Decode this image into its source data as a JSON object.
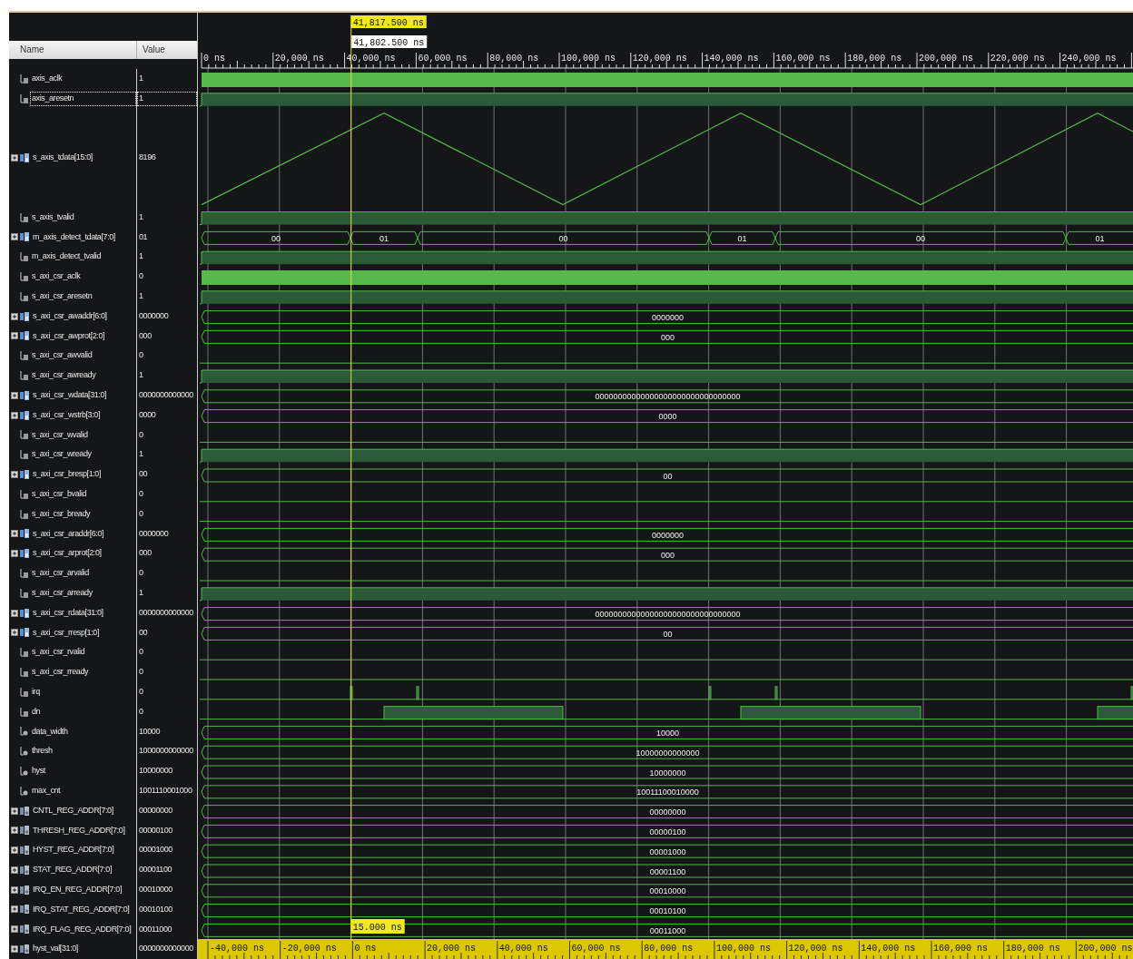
{
  "columns": {
    "name": "Name",
    "value": "Value"
  },
  "cursors": {
    "main": "41,817.500 ns",
    "secondary": "41,802.500 ns",
    "delta": "15.000 ns"
  },
  "time_ruler": [
    "0 ns",
    "20,000 ns",
    "40,000 ns",
    "60,000 ns",
    "80,000 ns",
    "100,000 ns",
    "120,000 ns",
    "140,000 ns",
    "160,000 ns",
    "180,000 ns",
    "200,000 ns",
    "220,000 ns",
    "240,000 ns"
  ],
  "relative_ruler": [
    "-40,000 ns",
    "-20,000 ns",
    "0 ns",
    "20,000 ns",
    "40,000 ns",
    "60,000 ns",
    "80,000 ns",
    "100,000 ns",
    "120,000 ns",
    "140,000 ns",
    "160,000 ns",
    "180,000 ns",
    "200,000 ns"
  ],
  "signals": [
    {
      "name": "axis_aclk",
      "value": "1",
      "expandable": false,
      "kind": "clock",
      "selected": false
    },
    {
      "name": "axis_aresetn",
      "value": "1",
      "expandable": false,
      "kind": "high",
      "selected": true
    },
    {
      "name": "s_axis_tdata[15:0]",
      "value": "8196",
      "expandable": true,
      "kind": "analog",
      "selected": false
    },
    {
      "name": "s_axis_tvalid",
      "value": "1",
      "expandable": false,
      "kind": "high",
      "selected": false
    },
    {
      "name": "m_axis_detect_tdata[7:0]",
      "value": "01",
      "expandable": true,
      "kind": "bus",
      "selected": false,
      "segments": [
        {
          "label": "00"
        },
        {
          "label": "01"
        },
        {
          "label": "00"
        },
        {
          "label": "01"
        },
        {
          "label": "00"
        },
        {
          "label": "01"
        }
      ]
    },
    {
      "name": "m_axis_detect_tvalid",
      "value": "1",
      "expandable": false,
      "kind": "high",
      "selected": false
    },
    {
      "name": "s_axi_csr_aclk",
      "value": "0",
      "expandable": false,
      "kind": "clock",
      "selected": false
    },
    {
      "name": "s_axi_csr_aresetn",
      "value": "1",
      "expandable": false,
      "kind": "high",
      "selected": false
    },
    {
      "name": "s_axi_csr_awaddr[6:0]",
      "value": "0000000",
      "expandable": true,
      "kind": "bus",
      "selected": false,
      "segments": [
        {
          "label": "0000000"
        }
      ]
    },
    {
      "name": "s_axi_csr_awprot[2:0]",
      "value": "000",
      "expandable": true,
      "kind": "bus",
      "selected": false,
      "segments": [
        {
          "label": "000"
        }
      ]
    },
    {
      "name": "s_axi_csr_awvalid",
      "value": "0",
      "expandable": false,
      "kind": "low",
      "selected": false
    },
    {
      "name": "s_axi_csr_awready",
      "value": "1",
      "expandable": false,
      "kind": "high",
      "selected": false
    },
    {
      "name": "s_axi_csr_wdata[31:0]",
      "value": "0000000000000",
      "expandable": true,
      "kind": "bus",
      "selected": false,
      "segments": [
        {
          "label": "00000000000000000000000000000000"
        }
      ]
    },
    {
      "name": "s_axi_csr_wstrb[3:0]",
      "value": "0000",
      "expandable": true,
      "kind": "bus",
      "selected": false,
      "segments": [
        {
          "label": "0000"
        }
      ]
    },
    {
      "name": "s_axi_csr_wvalid",
      "value": "0",
      "expandable": false,
      "kind": "low",
      "selected": false
    },
    {
      "name": "s_axi_csr_wready",
      "value": "1",
      "expandable": false,
      "kind": "high",
      "selected": false
    },
    {
      "name": "s_axi_csr_bresp[1:0]",
      "value": "00",
      "expandable": true,
      "kind": "bus",
      "selected": false,
      "segments": [
        {
          "label": "00"
        }
      ]
    },
    {
      "name": "s_axi_csr_bvalid",
      "value": "0",
      "expandable": false,
      "kind": "low",
      "selected": false
    },
    {
      "name": "s_axi_csr_bready",
      "value": "0",
      "expandable": false,
      "kind": "low",
      "selected": false
    },
    {
      "name": "s_axi_csr_araddr[6:0]",
      "value": "0000000",
      "expandable": true,
      "kind": "bus",
      "selected": false,
      "segments": [
        {
          "label": "0000000"
        }
      ]
    },
    {
      "name": "s_axi_csr_arprot[2:0]",
      "value": "000",
      "expandable": true,
      "kind": "bus",
      "selected": false,
      "segments": [
        {
          "label": "000"
        }
      ]
    },
    {
      "name": "s_axi_csr_arvalid",
      "value": "0",
      "expandable": false,
      "kind": "low",
      "selected": false
    },
    {
      "name": "s_axi_csr_arready",
      "value": "1",
      "expandable": false,
      "kind": "high",
      "selected": false
    },
    {
      "name": "s_axi_csr_rdata[31:0]",
      "value": "0000000000000",
      "expandable": true,
      "kind": "bus",
      "selected": false,
      "segments": [
        {
          "label": "00000000000000000000000000000000"
        }
      ]
    },
    {
      "name": "s_axi_csr_rresp[1:0]",
      "value": "00",
      "expandable": true,
      "kind": "bus",
      "selected": false,
      "segments": [
        {
          "label": "00"
        }
      ]
    },
    {
      "name": "s_axi_csr_rvalid",
      "value": "0",
      "expandable": false,
      "kind": "low",
      "selected": false
    },
    {
      "name": "s_axi_csr_rready",
      "value": "0",
      "expandable": false,
      "kind": "low",
      "selected": false
    },
    {
      "name": "irq",
      "value": "0",
      "expandable": false,
      "kind": "spikes",
      "selected": false
    },
    {
      "name": "dn",
      "value": "0",
      "expandable": false,
      "kind": "pulses",
      "selected": false
    },
    {
      "name": "data_width",
      "value": "10000",
      "expandable": false,
      "kind": "bus",
      "selected": false,
      "segments": [
        {
          "label": "10000"
        }
      ]
    },
    {
      "name": "thresh",
      "value": "1000000000000",
      "expandable": false,
      "kind": "bus",
      "selected": false,
      "segments": [
        {
          "label": "10000000000000"
        }
      ]
    },
    {
      "name": "hyst",
      "value": "10000000",
      "expandable": false,
      "kind": "bus",
      "selected": false,
      "segments": [
        {
          "label": "10000000"
        }
      ]
    },
    {
      "name": "max_cnt",
      "value": "1001110001000",
      "expandable": false,
      "kind": "bus",
      "selected": false,
      "segments": [
        {
          "label": "10011100010000"
        }
      ]
    },
    {
      "name": "CNTL_REG_ADDR[7:0]",
      "value": "00000000",
      "expandable": true,
      "kind": "bus",
      "selected": false,
      "segments": [
        {
          "label": "00000000"
        }
      ]
    },
    {
      "name": "THRESH_REG_ADDR[7:0]",
      "value": "00000100",
      "expandable": true,
      "kind": "bus",
      "selected": false,
      "segments": [
        {
          "label": "00000100"
        }
      ]
    },
    {
      "name": "HYST_REG_ADDR[7:0]",
      "value": "00001000",
      "expandable": true,
      "kind": "bus",
      "selected": false,
      "segments": [
        {
          "label": "00001000"
        }
      ]
    },
    {
      "name": "STAT_REG_ADDR[7:0]",
      "value": "00001100",
      "expandable": true,
      "kind": "bus",
      "selected": false,
      "segments": [
        {
          "label": "00001100"
        }
      ]
    },
    {
      "name": "IRQ_EN_REG_ADDR[7:0]",
      "value": "00010000",
      "expandable": true,
      "kind": "bus",
      "selected": false,
      "segments": [
        {
          "label": "00010000"
        }
      ]
    },
    {
      "name": "IRQ_STAT_REG_ADDR[7:0]",
      "value": "00010100",
      "expandable": true,
      "kind": "bus",
      "selected": false,
      "segments": [
        {
          "label": "00010100"
        }
      ]
    },
    {
      "name": "IRQ_FLAG_REG_ADDR[7:0]",
      "value": "00011000",
      "expandable": true,
      "kind": "bus",
      "selected": false,
      "segments": [
        {
          "label": "00011000"
        }
      ]
    },
    {
      "name": "hyst_val[31:0]",
      "value": "0000000000000",
      "expandable": true,
      "kind": "bus",
      "selected": false
    }
  ]
}
